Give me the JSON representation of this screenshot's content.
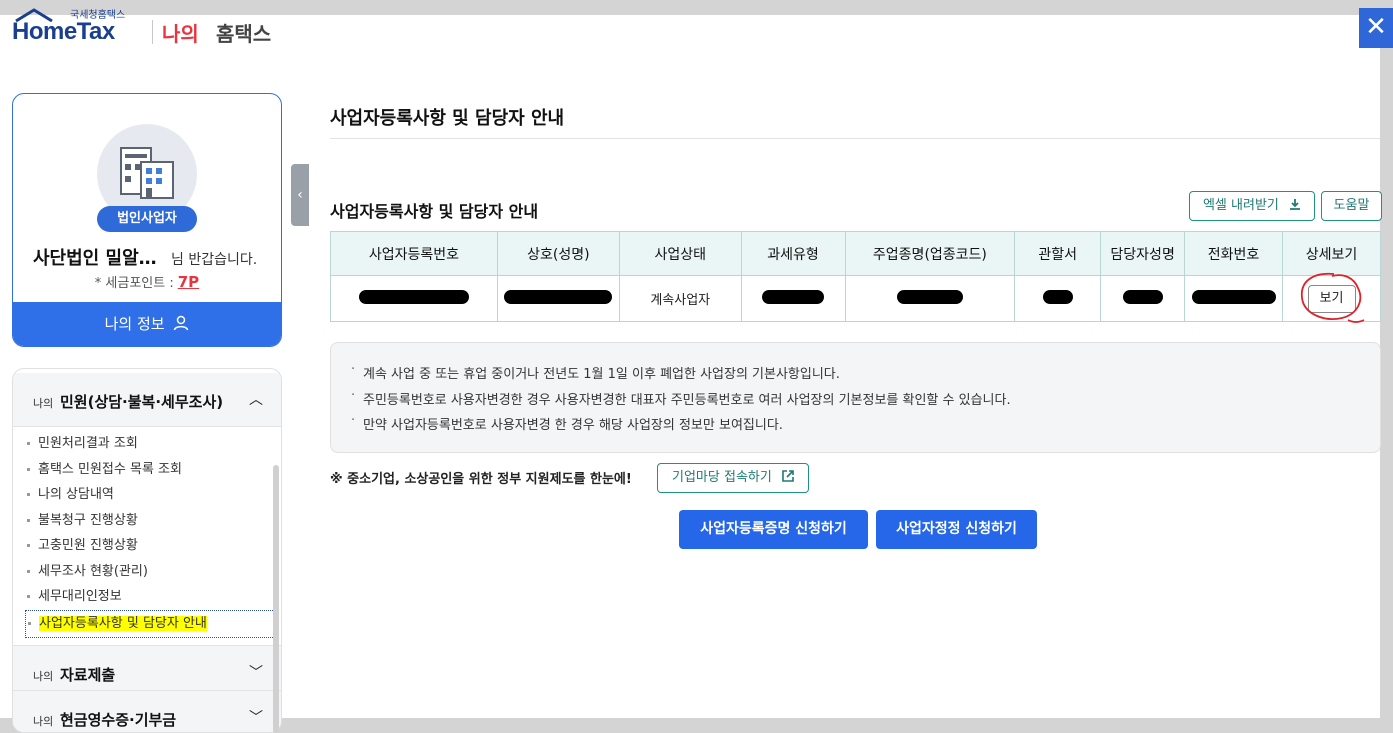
{
  "header": {
    "logo_small": "국세청홈택스",
    "logo_main": "HomeTax",
    "my": "나의",
    "hometax": "홈택스",
    "close": "✕"
  },
  "profile": {
    "badge": "법인사업자",
    "name": "사단법인 밀알…",
    "greeting": "님 반갑습니다.",
    "points_label": "* 세금포인트 :",
    "points_value": "7P",
    "my_info_button": "나의 정보"
  },
  "menu": {
    "sections": [
      {
        "prefix": "나의",
        "title": "민원(상담·불복·세무조사)",
        "expanded": true
      },
      {
        "prefix": "나의",
        "title": "자료제출",
        "expanded": false
      },
      {
        "prefix": "나의",
        "title": "현금영수증·기부금",
        "expanded": false
      }
    ],
    "items": [
      "민원처리결과 조회",
      "홈택스 민원접수 목록 조회",
      "나의 상담내역",
      "불복청구 진행상황",
      "고충민원 진행상황",
      "세무조사 현황(관리)",
      "세무대리인정보",
      "사업자등록사항 및 담당자 안내"
    ]
  },
  "main": {
    "page_title": "사업자등록사항 및 담당자 안내",
    "section_title": "사업자등록사항 및 담당자 안내",
    "excel_button": "엑셀 내려받기",
    "help_button": "도움말",
    "table": {
      "headers": [
        "사업자등록번호",
        "상호(성명)",
        "사업상태",
        "과세유형",
        "주업종명(업종코드)",
        "관할서",
        "담당자성명",
        "전화번호",
        "상세보기"
      ],
      "row": {
        "status": "계속사업자",
        "view_button": "보기"
      }
    },
    "notices": [
      "계속 사업 중 또는 휴업 중이거나 전년도 1월 1일 이후 폐업한 사업장의 기본사항입니다.",
      "주민등록번호로 사용자변경한 경우 사용자변경한 대표자 주민등록번호로 여러 사업장의 기본정보를 확인할 수 있습니다.",
      "만약 사업자등록번호로 사용자변경 한 경우 해당 사업장의 정보만 보여집니다."
    ],
    "smb_text": "※ 중소기업, 소상공인을 위한 정부 지원제도를 한눈에!",
    "corp_button": "기업마당 접속하기",
    "cert_button": "사업자등록증명 신청하기",
    "correct_button": "사업자정정 신청하기"
  },
  "colors": {
    "primary": "#2567e8",
    "teal": "#1e9088",
    "accent_red": "#e8343f",
    "highlight": "#ffff00"
  }
}
